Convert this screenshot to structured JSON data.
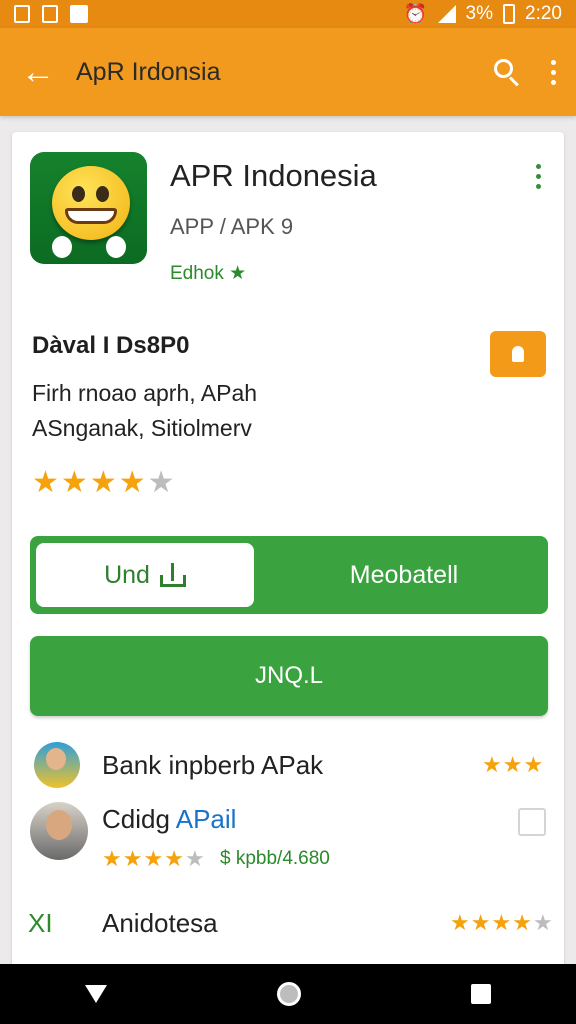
{
  "status_bar": {
    "time": "2:20",
    "battery": "3%"
  },
  "app_bar": {
    "back_glyph": "←",
    "title": "ApR Irdonsia",
    "search_icon": "search-icon",
    "menu_icon": "more-vert-icon"
  },
  "app": {
    "name": "APR Indonesia",
    "subtitle": "APP / APK 9",
    "developer": "Edhok ★",
    "icon": "smiley-app-icon"
  },
  "details": {
    "title": "Dàval I Ds8P0",
    "line1": "Firh rnoao aprh, APah",
    "line2": "ASnganak, Sitiolmerv",
    "rating_stars": 4,
    "rating_max": 5
  },
  "buttons": {
    "split_left": "Und",
    "split_right": "Meobatell",
    "main": "JNQ.L"
  },
  "list": [
    {
      "title": "Bank inpberb APak",
      "stars": 3
    },
    {
      "title_prefix": "Cdidg",
      "title_link": "APail",
      "stars": 4,
      "meta": "$ kpbb/4.680"
    },
    {
      "logo": "XI",
      "title": "Anidotesa",
      "stars": 4
    }
  ],
  "colors": {
    "accent": "#f19a1e",
    "primary_green": "#3aa33f",
    "star": "#f6a20c"
  }
}
